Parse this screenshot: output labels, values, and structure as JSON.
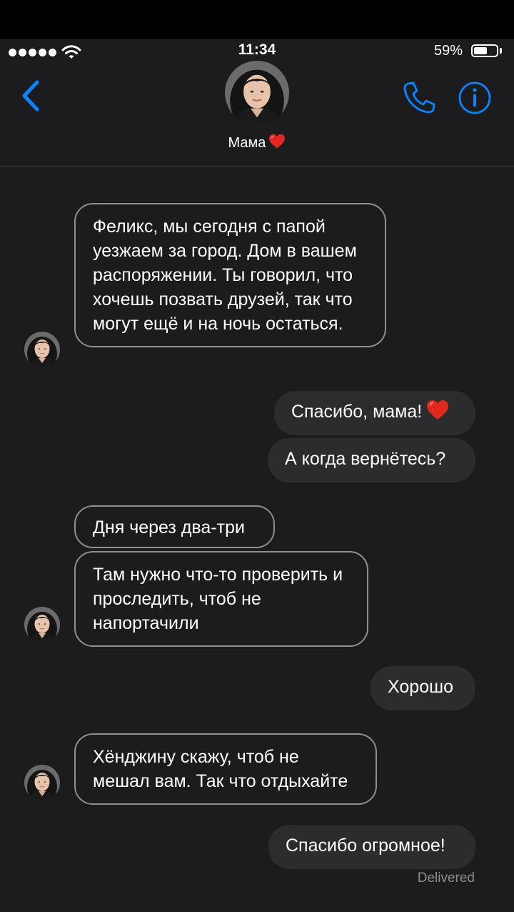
{
  "status_bar": {
    "time": "11:34",
    "battery_percent": "59%",
    "battery_level": 0.59,
    "wifi_icon": "wifi-icon",
    "signal_icon": "signal-dots-icon"
  },
  "header": {
    "contact_name": "Мама",
    "back_icon": "chevron-left-icon",
    "call_icon": "phone-icon",
    "info_icon": "info-icon",
    "accent_color": "#0a84ff"
  },
  "messages": [
    {
      "direction": "incoming",
      "text": "Феликс, мы сегодня с папой уезжаем за город. Дом в вашем распоряжении. Ты говорил, что хочешь позвать друзей, так что могут ещё и на ночь остаться."
    },
    {
      "direction": "outgoing",
      "text": "Спасибо, мама!"
    },
    {
      "direction": "outgoing",
      "text": "А когда вернётесь?"
    },
    {
      "direction": "incoming",
      "text": "Дня через два-три"
    },
    {
      "direction": "incoming",
      "text": "Там нужно что-то проверить и проследить, чтоб не напортачили"
    },
    {
      "direction": "outgoing",
      "text": "Хорошо"
    },
    {
      "direction": "incoming",
      "text": "Хёнджину скажу, чтоб не мешал вам. Так что отдыхайте"
    },
    {
      "direction": "outgoing",
      "text": "Спасибо огромное!"
    }
  ],
  "delivery_status": "Delivered",
  "colors": {
    "background": "#1c1c1e",
    "outgoing_bubble": "#2c2c2e",
    "incoming_border": "#8e8e93",
    "heart": "#e0281e"
  }
}
